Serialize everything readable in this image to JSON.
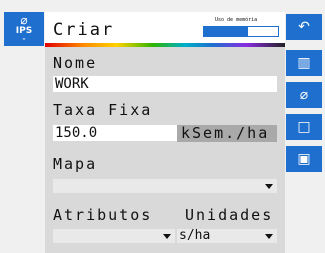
{
  "ips_tile": {
    "icon": "satellite-icon",
    "text": "IPS"
  },
  "header": {
    "title": "Criar",
    "memory_label": "Uso de memória",
    "memory_usage": 0.6
  },
  "form": {
    "name_label": "Nome",
    "name_value": "WORK",
    "rate_label": "Taxa Fixa",
    "rate_value": "150.0",
    "rate_unit": "kSem./ha",
    "map_label": "Mapa",
    "map_value": "",
    "attributes_label": "Atributos",
    "units_label": "Unidades",
    "attribute_value": "",
    "unit_value": "s/ha"
  },
  "sidebar": {
    "buttons": [
      {
        "icon": "back-icon"
      },
      {
        "icon": "map-icon"
      },
      {
        "icon": "satellite-icon"
      },
      {
        "icon": "stop-icon"
      },
      {
        "icon": "save-icon"
      }
    ]
  },
  "colors": {
    "accent": "#1f6fcf",
    "panel": "#d9d9d9",
    "unit_box": "#a9a9a9"
  }
}
